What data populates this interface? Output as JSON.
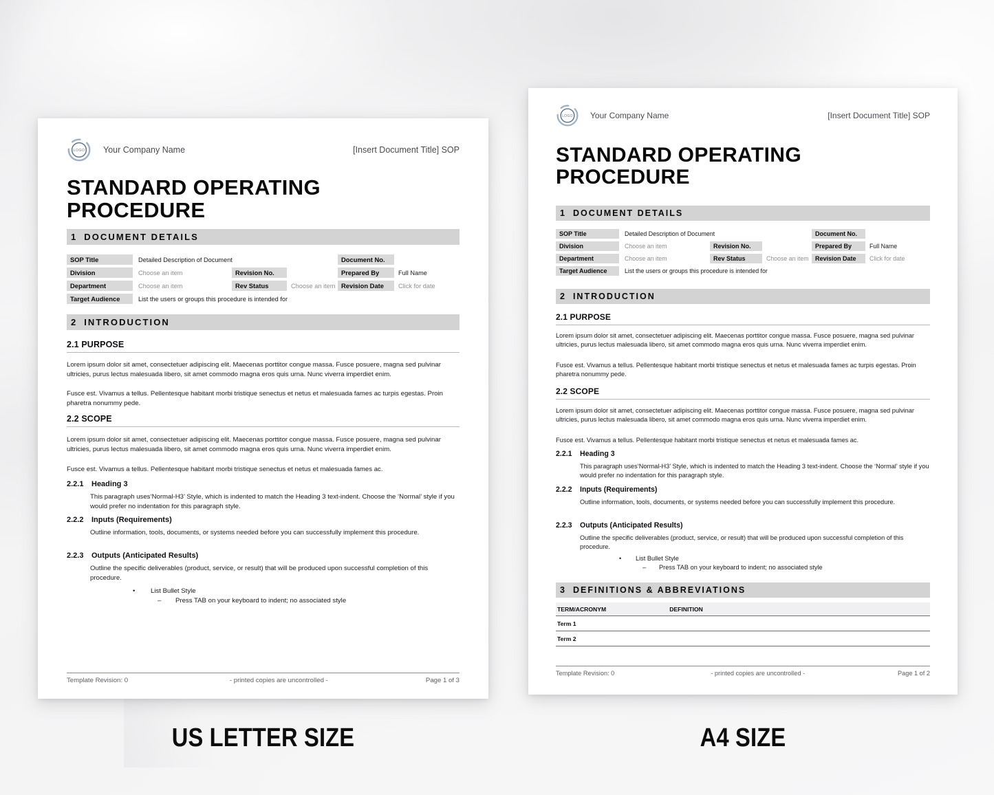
{
  "background": {
    "base_color": "#f4f4f5",
    "sheet_color": "#ffffff",
    "band_color": "#d3d3d3",
    "label_color": "#d9d9d9"
  },
  "logo": {
    "text": "LOGO",
    "name": "company-logo-ring"
  },
  "header": {
    "company_name": "Your Company Name",
    "document_title_right": "[Insert Document Title] SOP"
  },
  "title": "STANDARD OPERATING PROCEDURE",
  "sections": {
    "one": {
      "number": "1",
      "title": "DOCUMENT DETAILS"
    },
    "two": {
      "number": "2",
      "title": "INTRODUCTION"
    },
    "three": {
      "number": "3",
      "title": "DEFINITIONS & ABBREVIATIONS"
    }
  },
  "details": {
    "sop_title_label": "SOP Title",
    "sop_title_value": "Detailed Description of Document",
    "document_no_label": "Document No.",
    "document_no_value": "",
    "division_label": "Division",
    "division_value": "Choose an item",
    "revision_no_label": "Revision No.",
    "revision_no_value": "",
    "prepared_by_label": "Prepared By",
    "prepared_by_value": "Full Name",
    "department_label": "Department",
    "department_value": "Choose an item",
    "rev_status_label": "Rev Status",
    "rev_status_value": "Choose an item",
    "revision_date_label": "Revision Date",
    "revision_date_value": "Click for date",
    "target_audience_label": "Target Audience",
    "target_audience_value": "List the users or groups this procedure is intended for"
  },
  "introduction": {
    "purpose_heading": "2.1 PURPOSE",
    "purpose_p1": "Lorem ipsum dolor sit amet, consectetuer adipiscing elit. Maecenas porttitor congue massa. Fusce posuere, magna sed pulvinar ultricies, purus lectus malesuada libero, sit amet commodo magna eros quis urna. Nunc viverra imperdiet enim.",
    "purpose_p2": "Fusce est. Vivamus a tellus. Pellentesque habitant morbi tristique senectus et netus et malesuada fames ac turpis egestas. Proin pharetra nonummy pede.",
    "scope_heading": "2.2 SCOPE",
    "scope_p1": "Lorem ipsum dolor sit amet, consectetuer adipiscing elit. Maecenas porttitor congue massa. Fusce posuere, magna sed pulvinar ultricies, purus lectus malesuada libero, sit amet commodo magna eros quis urna. Nunc viverra imperdiet enim.",
    "scope_p2": "Fusce est. Vivamus a tellus. Pellentesque habitant morbi tristique senectus et netus et malesuada fames ac.",
    "h3_1_num": "2.2.1",
    "h3_1_title": "Heading 3",
    "h3_1_body": "This paragraph uses‘Normal-H3’ Style, which is indented to match the Heading 3 text-indent. Choose the ‘Normal’ style if you would prefer no indentation for this paragraph style.",
    "h3_2_num": "2.2.2",
    "h3_2_title": "Inputs (Requirements)",
    "h3_2_body": "Outline information, tools, documents, or systems needed before you can successfully implement this procedure.",
    "h3_3_num": "2.2.3",
    "h3_3_title": "Outputs (Anticipated Results)",
    "h3_3_body": "Outline the specific deliverables (product, service, or result) that will be produced upon successful completion of this procedure.",
    "bullet_1_mark": "•",
    "bullet_1_text": "List Bullet Style",
    "bullet_2_mark": "–",
    "bullet_2_text": "Press TAB on your keyboard to indent; no associated style"
  },
  "definitions": {
    "col_term": "TERM/ACRONYM",
    "col_definition": "DEFINITION",
    "rows": [
      {
        "term": "Term 1",
        "definition": ""
      },
      {
        "term": "Term 2",
        "definition": ""
      }
    ]
  },
  "footer_letter": {
    "left": "Template Revision: 0",
    "center": "- printed copies are uncontrolled -",
    "right": "Page 1 of 3"
  },
  "footer_a4": {
    "left": "Template Revision: 0",
    "center": "- printed copies are uncontrolled -",
    "right": "Page 1 of 2"
  },
  "captions": {
    "letter": "US LETTER SIZE",
    "a4": "A4 SIZE"
  }
}
